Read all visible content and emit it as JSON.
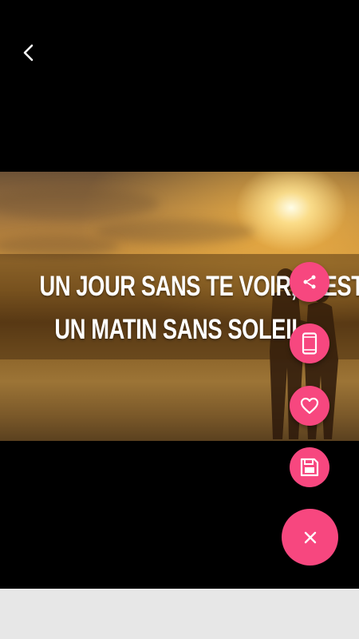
{
  "toolbar": {
    "back_icon": "arrow-back-icon"
  },
  "image": {
    "quote_line1": "UN JOUR SANS TE VOIR, C'EST",
    "quote_line2": "UN MATIN SANS SOLEIL"
  },
  "fab_menu": {
    "accent_color": "#f7477f",
    "actions": [
      {
        "icon": "share-icon"
      },
      {
        "icon": "phone-wallpaper-icon"
      },
      {
        "icon": "heart-icon"
      },
      {
        "icon": "save-icon"
      }
    ],
    "close_icon": "close-icon"
  },
  "colors": {
    "background": "#000000",
    "bottom_bar": "#e7e7e7"
  }
}
